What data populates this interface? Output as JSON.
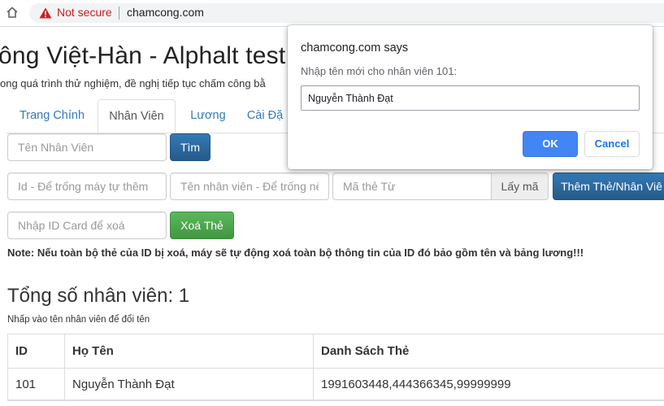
{
  "browser": {
    "security_label": "Not secure",
    "url": "chamcong.com",
    "security_color": "#c5221f"
  },
  "page": {
    "title": "ông Việt-Hàn - Alphalt test",
    "subtitle": "ong quá trình thử nghiệm, đề nghị tiếp tục chấm công bằ"
  },
  "tabs": [
    {
      "label": "Trang Chính",
      "active": false
    },
    {
      "label": "Nhân Viên",
      "active": true
    },
    {
      "label": "Lương",
      "active": false
    },
    {
      "label": "Cài Đặ",
      "active": false
    }
  ],
  "search": {
    "placeholder": "Tên Nhân Viên",
    "button_label": "Tìm"
  },
  "add_card": {
    "id_placeholder": "Id - Để trống máy tự thêm",
    "name_placeholder": "Tên nhân viên - Để trống nế",
    "card_placeholder": "Mã thẻ Từ",
    "get_code_label": "Lấy mã",
    "add_button_label": "Thêm Thẻ/Nhân Viê"
  },
  "delete_card": {
    "placeholder": "Nhập ID Card để xoá",
    "button_label": "Xoá Thẻ"
  },
  "note": "Note: Nếu toàn bộ thẻ của ID bị xoá, máy sẽ tự động xoá toàn bộ thông tin của ID đó bảo gồm tên và bảng lương!!!",
  "summary": {
    "total_label": "Tổng số nhân viên: 1",
    "hint": "Nhấp vào tên nhân viên để đổi tên"
  },
  "table": {
    "headers": [
      "ID",
      "Họ Tên",
      "Danh Sách Thẻ"
    ],
    "rows": [
      [
        "101",
        "Nguyễn Thành Đạt",
        "1991603448,444366345,99999999"
      ]
    ]
  },
  "dialog": {
    "title": "chamcong.com says",
    "message": "Nhập tên mới cho nhân viên 101:",
    "value": "Nguyễn Thành Đạt",
    "ok_label": "OK",
    "cancel_label": "Cancel"
  },
  "icons": {
    "home": "home-icon",
    "warning": "warning-icon"
  },
  "colors": {
    "link": "#337ab7",
    "primary": "#286090",
    "success": "#5cb85c",
    "dialog_ok": "#4285f4"
  }
}
